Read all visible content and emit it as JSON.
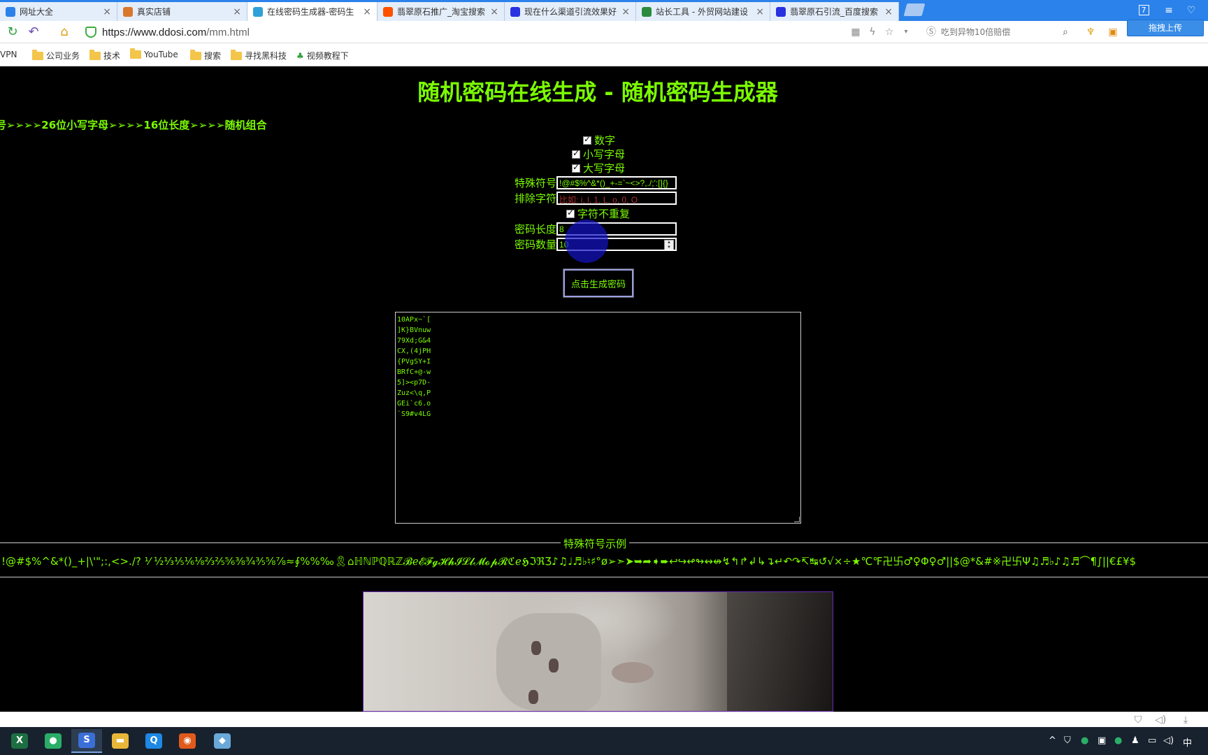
{
  "browser": {
    "tabs": [
      {
        "title": "网址大全",
        "active": false,
        "icon_color": "#2b82ea"
      },
      {
        "title": "真实店铺",
        "active": false,
        "icon_color": "#d9772b"
      },
      {
        "title": "在线密码生成器-密码生",
        "active": true,
        "icon_color": "#2fa0d8"
      },
      {
        "title": "翡翠原石推广_淘宝搜索",
        "active": false,
        "icon_color": "#ff5000"
      },
      {
        "title": "现在什么渠道引流效果好",
        "active": false,
        "icon_color": "#2932e1"
      },
      {
        "title": "站长工具 - 外贸网站建设",
        "active": false,
        "icon_color": "#2b8a3e"
      },
      {
        "title": "翡翠原石引流_百度搜索",
        "active": false,
        "icon_color": "#2932e1"
      }
    ],
    "tab_count_badge": "7",
    "url_host": "https://www.ddosi.com",
    "url_path": "/mm.html",
    "search_placeholder": "吃到异物10倍赔偿",
    "upload_label": "拖拽上传",
    "bookmarks": [
      {
        "label": "VPN",
        "type": "folder-less"
      },
      {
        "label": "公司业务",
        "type": "folder"
      },
      {
        "label": "技术",
        "type": "folder"
      },
      {
        "label": "YouTube",
        "type": "folder"
      },
      {
        "label": "搜索",
        "type": "folder"
      },
      {
        "label": "寻找黑科技",
        "type": "folder"
      },
      {
        "label": "视频教程下",
        "type": "link"
      }
    ]
  },
  "page": {
    "title": "随机密码在线生成 - 随机密码生成器",
    "marquee": "号➢➢➢➢26位小写字母➢➢➢➢16位长度➢➢➢➢随机组合",
    "options": {
      "digits_label": "数字",
      "lowercase_label": "小写字母",
      "uppercase_label": "大写字母",
      "special_label": "特殊符号",
      "special_value": "!@#$%^&*()_+-=`~<>?,./;':[]{}",
      "exclude_label": "排除字符",
      "exclude_placeholder": "比如: i, l, 1, L, o, 0, O",
      "unique_label": "字符不重复",
      "length_label": "密码长度",
      "length_value": "8",
      "count_label": "密码数量",
      "count_value": "10"
    },
    "generate_button": "点击生成密码",
    "passwords": [
      "10APx~`[",
      "]K}BVnuw",
      "79Xd;G&4",
      "CX,(4jPH",
      "{PVgSY+I",
      "BRfC+@-w",
      "5]><p7D-",
      "Zuz<\\q,P",
      "GEi`c6.o",
      "`S9#v4LG"
    ],
    "symbols_legend": "特殊符号示例",
    "symbols_text": "!@#$%^&*()_+|\\'\";:,<>./? ⅟ ½⅓⅕⅙⅛⅔⅖⅚⅜¾⅗⅝⅞≈∮%%‰🎗⌂ℍℕℙℚℝℤ𝓑ℯ𝓔𝓕𝓰𝓗𝓱𝓘𝓛𝓵𝓜𝓸𝓹𝓡ℭℯ𝕳ℑℜƷ♪♫♩♬♭♮♯°ø➢➣➤➥➦➧➨↩↪↫↬↭↮↯↰↱↲↳↴↵↶↷↸↹↺√×÷★℃℉卍卐♂♀Φ♀♂||$@*&#※卍卐Ψ♫♬♭♪♫♬⌒¶∫||€£¥$"
  },
  "taskbar": {
    "apps": [
      {
        "name": "excel",
        "glyph": "X",
        "color": "#1d6f42"
      },
      {
        "name": "wechat",
        "glyph": "●",
        "color": "#2aae67"
      },
      {
        "name": "sogou",
        "glyph": "S",
        "color": "#3b6fd8"
      },
      {
        "name": "explorer",
        "glyph": "▬",
        "color": "#e8b73a"
      },
      {
        "name": "qq-browser",
        "glyph": "Q",
        "color": "#1e88e5"
      },
      {
        "name": "game",
        "glyph": "◉",
        "color": "#e05a1c"
      },
      {
        "name": "tool",
        "glyph": "◆",
        "color": "#6aa8d8"
      }
    ],
    "ime": "中"
  }
}
